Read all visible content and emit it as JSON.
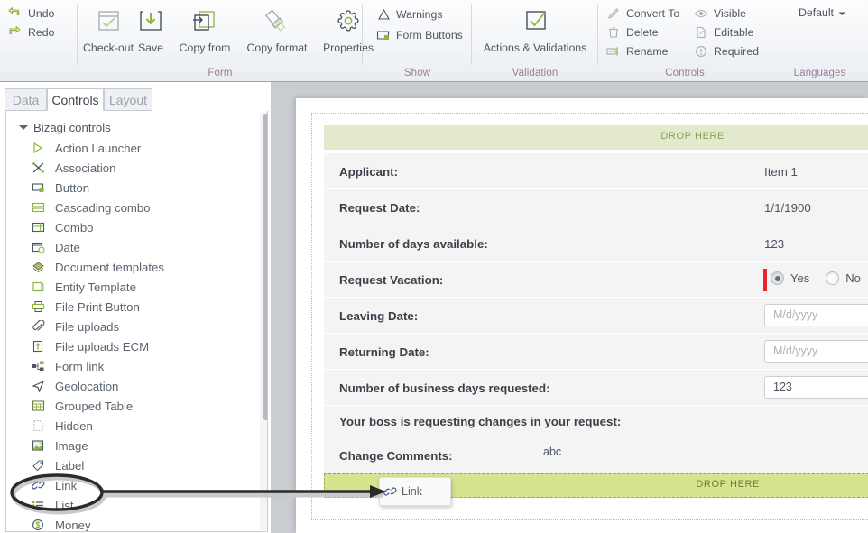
{
  "ribbon": {
    "quick": [
      {
        "label": "Undo",
        "icon": "undo-arrow-icon"
      },
      {
        "label": "Redo",
        "icon": "redo-arrow-icon"
      }
    ],
    "groups": [
      {
        "name": "Form",
        "label": "Form",
        "buttons": [
          {
            "label": "Check-out",
            "icon": "check-out-icon"
          },
          {
            "label": "Save",
            "icon": "save-download-icon"
          },
          {
            "label": "Copy from",
            "icon": "copy-from-icon"
          },
          {
            "label": "Copy format",
            "icon": "paintbrush-icon"
          },
          {
            "label": "Properties",
            "icon": "gear-icon"
          }
        ]
      },
      {
        "name": "Show",
        "label": "Show",
        "items": [
          {
            "label": "Warnings",
            "icon": "warning-triangle-icon"
          },
          {
            "label": "Form Buttons",
            "icon": "form-buttons-icon"
          }
        ]
      },
      {
        "name": "Validation",
        "label": "Validation",
        "buttons": [
          {
            "label": "Actions & Validations",
            "icon": "checkmark-box-icon"
          }
        ]
      },
      {
        "name": "Controls",
        "label": "Controls",
        "items": [
          {
            "label": "Convert To",
            "icon": "convert-pencil-icon"
          },
          {
            "label": "Delete",
            "icon": "trash-icon"
          },
          {
            "label": "Rename",
            "icon": "rename-icon"
          },
          {
            "label": "Visible",
            "icon": "eye-icon"
          },
          {
            "label": "Editable",
            "icon": "editable-page-icon"
          },
          {
            "label": "Required",
            "icon": "required-exclamation-icon"
          }
        ]
      },
      {
        "name": "Languages",
        "label": "Languages",
        "dropdown": {
          "label": "Default",
          "icon": "chevron-down-icon"
        }
      }
    ]
  },
  "left_panel": {
    "tabs": [
      {
        "label": "Data",
        "active": false
      },
      {
        "label": "Controls",
        "active": true
      },
      {
        "label": "Layout",
        "active": false
      }
    ],
    "tree": {
      "root_label": "Bizagi controls",
      "items": [
        {
          "label": "Action Launcher",
          "icon": "play-triangle-icon"
        },
        {
          "label": "Association",
          "icon": "association-icon"
        },
        {
          "label": "Button",
          "icon": "button-icon"
        },
        {
          "label": "Cascading combo",
          "icon": "cascading-combo-icon"
        },
        {
          "label": "Combo",
          "icon": "combo-icon"
        },
        {
          "label": "Date",
          "icon": "calendar-clock-icon"
        },
        {
          "label": "Document templates",
          "icon": "document-templates-icon"
        },
        {
          "label": "Entity Template",
          "icon": "entity-template-icon"
        },
        {
          "label": "File Print Button",
          "icon": "printer-icon"
        },
        {
          "label": "File uploads",
          "icon": "paperclip-icon"
        },
        {
          "label": "File uploads ECM",
          "icon": "upload-arrow-icon"
        },
        {
          "label": "Form link",
          "icon": "form-link-icon"
        },
        {
          "label": "Geolocation",
          "icon": "geolocation-arrow-icon"
        },
        {
          "label": "Grouped Table",
          "icon": "grouped-table-icon"
        },
        {
          "label": "Hidden",
          "icon": "hidden-dashed-page-icon"
        },
        {
          "label": "Image",
          "icon": "image-icon"
        },
        {
          "label": "Label",
          "icon": "tag-label-icon"
        },
        {
          "label": "Link",
          "icon": "chain-link-icon"
        },
        {
          "label": "List",
          "icon": "list-icon"
        },
        {
          "label": "Money",
          "icon": "money-dollar-icon"
        }
      ]
    }
  },
  "form": {
    "drop_here_top": "DROP HERE",
    "drop_here_bottom": "DROP HERE",
    "rows": [
      {
        "label": "Applicant:",
        "type": "text",
        "value": "Item 1"
      },
      {
        "label": "Request Date:",
        "type": "text",
        "value": "1/1/1900"
      },
      {
        "label": "Number of days available:",
        "type": "text",
        "value": "123"
      },
      {
        "label": "Request Vacation:",
        "type": "radio",
        "options": [
          "Yes",
          "No"
        ],
        "selected": "Yes"
      },
      {
        "label": "Leaving Date:",
        "type": "input",
        "placeholder": "M/d/yyyy",
        "value": ""
      },
      {
        "label": "Returning Date:",
        "type": "input",
        "placeholder": "M/d/yyyy",
        "value": ""
      },
      {
        "label": "Number of business days requested:",
        "type": "input",
        "placeholder": "",
        "value": "123"
      },
      {
        "label": "Your boss is requesting changes in your request:",
        "type": "empty",
        "value": ""
      },
      {
        "label": "Change Comments:",
        "type": "text",
        "value": "abc"
      }
    ]
  },
  "drag_ghost": {
    "label": "Link",
    "icon": "chain-link-icon"
  },
  "colors": {
    "accent_green": "#8cb53c",
    "drop_zone": "#e3e9cd",
    "drop_zone_active": "#d6e48f",
    "group_label": "#9c7f94",
    "required_red": "#e8242a",
    "canvas_bg": "#c9ccd1"
  }
}
